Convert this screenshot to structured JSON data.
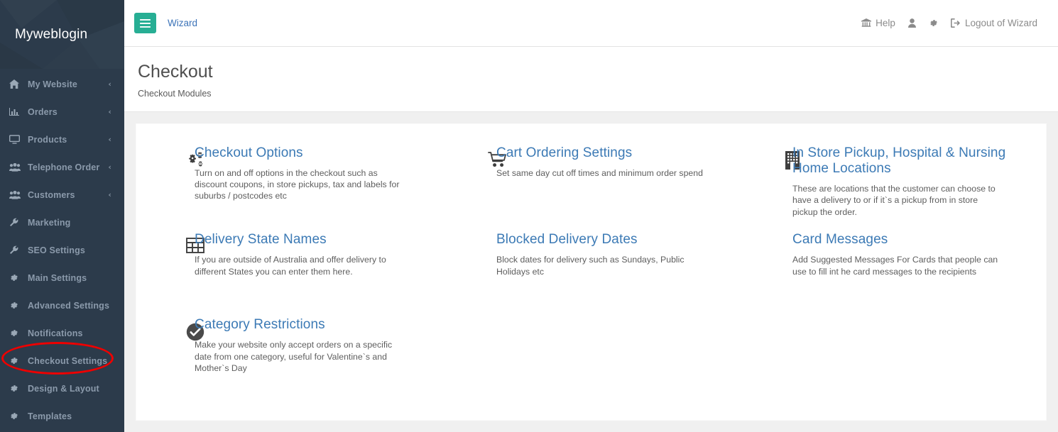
{
  "sidebar": {
    "brand": "Myweblogin",
    "items": [
      {
        "label": "My Website",
        "icon": "home-icon",
        "caret": "‹",
        "active": false
      },
      {
        "label": "Orders",
        "icon": "chart-bar-icon",
        "caret": "‹",
        "active": false
      },
      {
        "label": "Products",
        "icon": "desktop-icon",
        "caret": "‹",
        "active": false
      },
      {
        "label": "Telephone Order",
        "icon": "users-icon",
        "caret": "‹",
        "active": false
      },
      {
        "label": "Customers",
        "icon": "users-icon",
        "caret": "‹",
        "active": false
      },
      {
        "label": "Marketing",
        "icon": "wrench-icon",
        "caret": "",
        "active": false
      },
      {
        "label": "SEO Settings",
        "icon": "wrench-icon",
        "caret": "",
        "active": false
      },
      {
        "label": "Main Settings",
        "icon": "gear-icon",
        "caret": "",
        "active": false
      },
      {
        "label": "Advanced Settings",
        "icon": "gear-icon",
        "caret": "",
        "active": false
      },
      {
        "label": "Notifications",
        "icon": "gear-icon",
        "caret": "",
        "active": false
      },
      {
        "label": "Checkout Settings",
        "icon": "gear-icon",
        "caret": "",
        "active": true
      },
      {
        "label": "Design & Layout",
        "icon": "gear-icon",
        "caret": "",
        "active": false
      },
      {
        "label": "Templates",
        "icon": "gear-icon",
        "caret": "",
        "active": false
      }
    ]
  },
  "topbar": {
    "menu_toggle_icon": "hamburger-icon",
    "wizard_label": "Wizard",
    "help_label": "Help",
    "help_icon": "university-icon",
    "user_icon": "user-icon",
    "settings_icon": "gear-icon",
    "logout_icon": "sign-out-icon",
    "logout_label": "Logout of Wizard"
  },
  "page": {
    "title": "Checkout",
    "subtitle": "Checkout Modules"
  },
  "modules": [
    {
      "title": "Checkout Options",
      "desc": "Turn on and off options in the checkout such as discount coupons, in store pickups, tax and labels for suburbs / postcodes etc",
      "icon": "cogs-icon"
    },
    {
      "title": "Cart Ordering Settings",
      "desc": "Set same day cut off times and minimum order spend",
      "icon": "shopping-cart-icon"
    },
    {
      "title": "In Store Pickup, Hospital & Nursing Home Locations",
      "desc": "These are locations that the customer can choose to have a delivery to or if it`s a pickup from in store pickup the order.",
      "icon": "building-icon"
    },
    {
      "title": "Delivery State Names",
      "desc": "If you are outside of Australia and offer delivery to different States you can enter them here.",
      "icon": "table-icon"
    },
    {
      "title": "Blocked Delivery Dates",
      "desc": "Block dates for delivery such as Sundays, Public Holidays etc",
      "icon": ""
    },
    {
      "title": "Card Messages",
      "desc": "Add Suggested Messages For Cards that people can use to fill int he card messages to the recipients",
      "icon": ""
    },
    {
      "title": "Category Restrictions",
      "desc": "Make your website only accept orders on a specific date from one category, useful for Valentine`s and Mother`s Day",
      "icon": "check-circle-icon"
    }
  ],
  "annotation": {
    "shape": "ellipse",
    "color": "#ee0000",
    "target": "Checkout Settings"
  },
  "colors": {
    "sidebar_bg": "#2c3b4b",
    "accent_green": "#27ae94",
    "link_blue": "#3c7ab5",
    "annotation_red": "#ee0000",
    "page_bg": "#f0f0f0"
  }
}
